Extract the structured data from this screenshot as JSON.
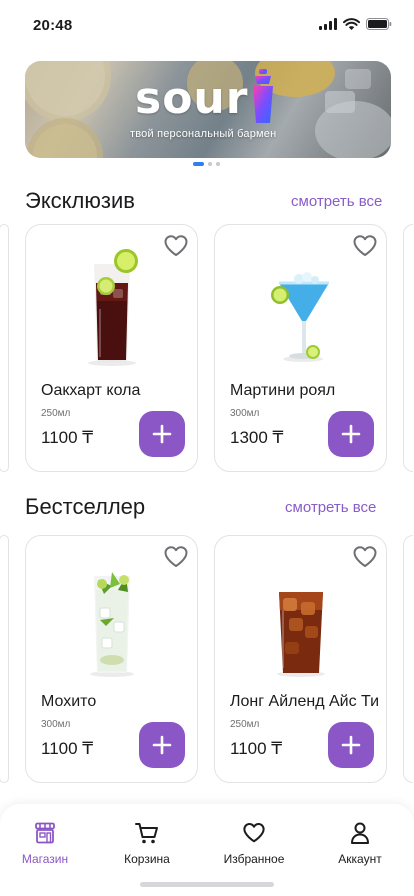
{
  "status_bar": {
    "time": "20:48"
  },
  "banner": {
    "logo": "sour",
    "tagline": "твой персональный бармен",
    "slide_count": 3,
    "active_slide": 1
  },
  "sections": [
    {
      "title": "Эксклюзив",
      "see_all": "смотреть все",
      "products": [
        {
          "name": "Оакхарт кола",
          "volume": "250мл",
          "price": "1100 ₸"
        },
        {
          "name": "Мартини роял",
          "volume": "300мл",
          "price": "1300 ₸"
        }
      ]
    },
    {
      "title": "Бестселлер",
      "see_all": "смотреть все",
      "products": [
        {
          "name": "Мохито",
          "volume": "300мл",
          "price": "1100 ₸"
        },
        {
          "name": "Лонг Айленд Айс Ти",
          "volume": "250мл",
          "price": "1100 ₸"
        }
      ]
    }
  ],
  "tab_bar": {
    "items": [
      {
        "label": "Магазин",
        "icon": "shop-icon",
        "active": true
      },
      {
        "label": "Корзина",
        "icon": "cart-icon",
        "active": false
      },
      {
        "label": "Избранное",
        "icon": "heart-icon",
        "active": false
      },
      {
        "label": "Аккаунт",
        "icon": "user-icon",
        "active": false
      }
    ]
  },
  "colors": {
    "accent": "#8b57c6",
    "dot_active": "#2f80ed",
    "card_border": "#e3e3e6"
  }
}
